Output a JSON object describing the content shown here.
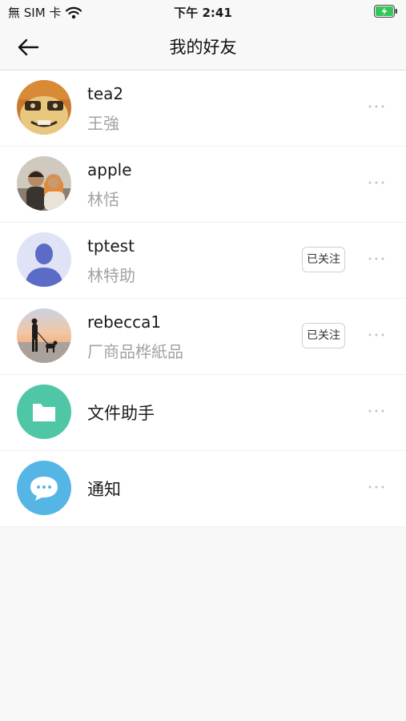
{
  "status_bar": {
    "carrier": "無 SIM 卡",
    "time": "下午 2:41"
  },
  "header": {
    "title": "我的好友",
    "back_icon": "arrow-left-icon"
  },
  "friends": [
    {
      "name": "tea2",
      "subtitle": "王強",
      "followed": false,
      "avatar": "cartoon-avatar"
    },
    {
      "name": "apple",
      "subtitle": "林恬",
      "followed": false,
      "avatar": "couple-photo-avatar"
    },
    {
      "name": "tptest",
      "subtitle": "林特助",
      "followed": true,
      "follow_label": "已关注",
      "avatar": "default-person-avatar"
    },
    {
      "name": "rebecca1",
      "subtitle": "厂商品桦紙品",
      "followed": true,
      "follow_label": "已关注",
      "avatar": "beach-photo-avatar"
    }
  ],
  "system_items": [
    {
      "label": "文件助手",
      "icon": "folder-icon",
      "color": "#4fc6a5"
    },
    {
      "label": "通知",
      "icon": "chat-bubble-icon",
      "color": "#55b6e6"
    }
  ],
  "more_icon": "more-horizontal-icon"
}
